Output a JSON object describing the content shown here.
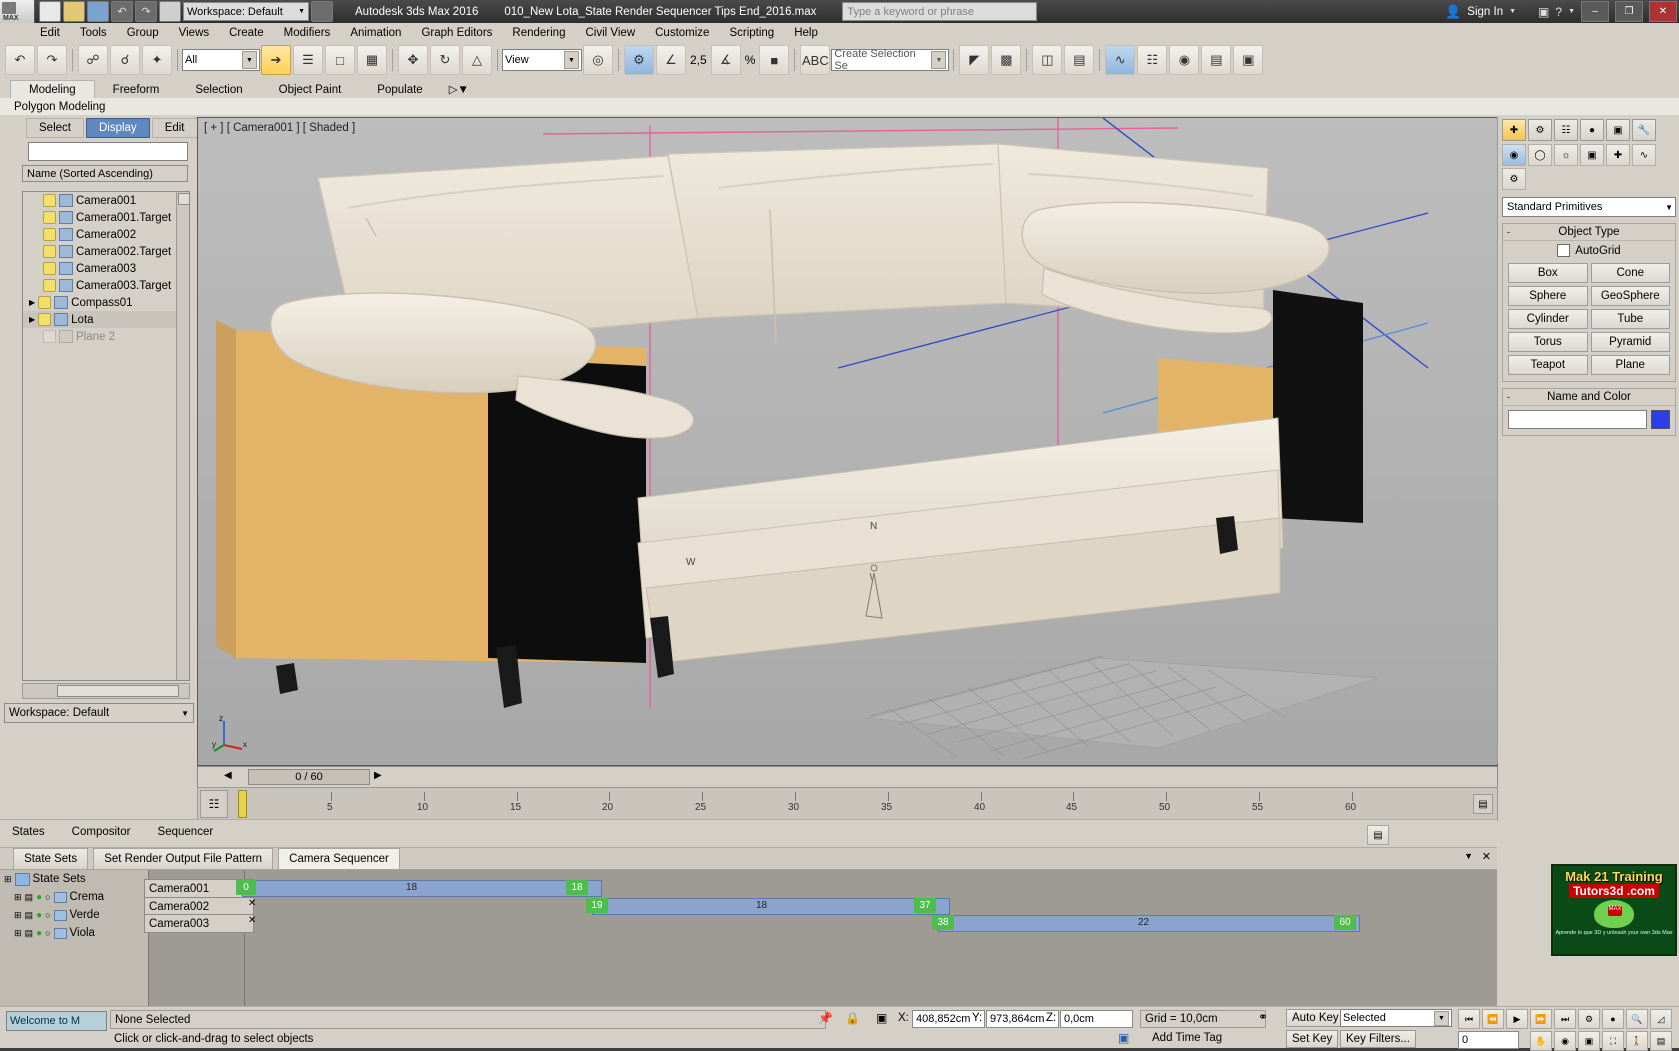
{
  "titlebar": {
    "app_title": "Autodesk 3ds Max 2016",
    "file_name": "010_New Lota_State Render Sequencer Tips End_2016.max",
    "workspace_label": "Workspace: Default",
    "keyword_placeholder": "Type a keyword or phrase",
    "signin": "Sign In",
    "min": "–",
    "max": "❐",
    "close": "✕",
    "max_logo": "MAX"
  },
  "menu": {
    "items": [
      "Edit",
      "Tools",
      "Group",
      "Views",
      "Create",
      "Modifiers",
      "Animation",
      "Graph Editors",
      "Rendering",
      "Civil View",
      "Customize",
      "Scripting",
      "Help"
    ]
  },
  "maintoolbar": {
    "selection_filter": "All",
    "ref_coord": "View",
    "selection_set_placeholder": "Create Selection Se",
    "angle_snap_value": "2,5",
    "percent_label": "%"
  },
  "ribbon": {
    "tabs": [
      "Modeling",
      "Freeform",
      "Selection",
      "Object Paint",
      "Populate"
    ],
    "active_tab": "Modeling",
    "subtitle": "Polygon Modeling"
  },
  "leftpanel": {
    "tabs": [
      "Select",
      "Display",
      "Edit"
    ],
    "active_tab": "Display",
    "list_header": "Name (Sorted Ascending)",
    "items": [
      {
        "label": "Camera001",
        "type": "camera"
      },
      {
        "label": "Camera001.Target",
        "type": "camera"
      },
      {
        "label": "Camera002",
        "type": "camera"
      },
      {
        "label": "Camera002.Target",
        "type": "camera"
      },
      {
        "label": "Camera003",
        "type": "camera"
      },
      {
        "label": "Camera003.Target",
        "type": "camera"
      },
      {
        "label": "Compass01",
        "type": "group"
      },
      {
        "label": "Lota",
        "type": "group"
      },
      {
        "label": "Plane 2",
        "type": "dim"
      }
    ],
    "workspace": "Workspace: Default"
  },
  "viewport": {
    "label": "[ + ] [ Camera001 ] [ Shaded ]",
    "axis_x": "x",
    "axis_y": "y",
    "axis_z": "z",
    "compass_n": "N",
    "compass_w": "W"
  },
  "timeline": {
    "frame_readout": "0 / 60",
    "ticks": [
      "5",
      "10",
      "15",
      "20",
      "25",
      "30",
      "35",
      "40",
      "45",
      "50",
      "55",
      "60"
    ]
  },
  "rightpanel": {
    "dropdown": "Standard Primitives",
    "object_type_title": "Object Type",
    "autogrid_label": "AutoGrid",
    "buttons": [
      "Box",
      "Cone",
      "Sphere",
      "GeoSphere",
      "Cylinder",
      "Tube",
      "Torus",
      "Pyramid",
      "Teapot",
      "Plane"
    ],
    "name_color_title": "Name and Color",
    "color_swatch": "#2c3ee8"
  },
  "bottomtabs": {
    "items": [
      "States",
      "Compositor",
      "Sequencer"
    ]
  },
  "statesets": {
    "tabs": [
      "State Sets",
      "Set Render Output File Pattern",
      "Camera Sequencer"
    ],
    "active_tab": "Camera Sequencer",
    "root_label": "State Sets",
    "rows": [
      {
        "label": "Crema"
      },
      {
        "label": "Verde"
      },
      {
        "label": "Viola"
      }
    ],
    "tracks": [
      {
        "name": "Camera001",
        "start": "0",
        "end": "18",
        "mid": "18"
      },
      {
        "name": "Camera002",
        "start": "19",
        "end": "37",
        "mid": "18"
      },
      {
        "name": "Camera003",
        "start": "38",
        "end": "60",
        "mid": "22"
      }
    ],
    "close_icon": "✕",
    "collapse_icon": "▼"
  },
  "logo": {
    "line1": "Mak 21 Training",
    "line2": "Tutors3d .com",
    "line3": "Aprende lo que 3D y unleash your own 3ds Max"
  },
  "statusbar": {
    "mini_listener": "Welcome to M",
    "selection_status": "None Selected",
    "prompt": "Click or click-and-drag to select objects",
    "x_label": "X:",
    "x_value": "408,852cm",
    "y_label": "Y:",
    "y_value": "973,864cm",
    "z_label": "Z:",
    "z_value": "0,0cm",
    "grid_label": "Grid = 10,0cm",
    "add_time_tag": "Add Time Tag",
    "auto_key": "Auto Key",
    "set_key": "Set Key",
    "key_filters": "Key Filters...",
    "key_mode": "Selected",
    "spinner_value": "0"
  }
}
